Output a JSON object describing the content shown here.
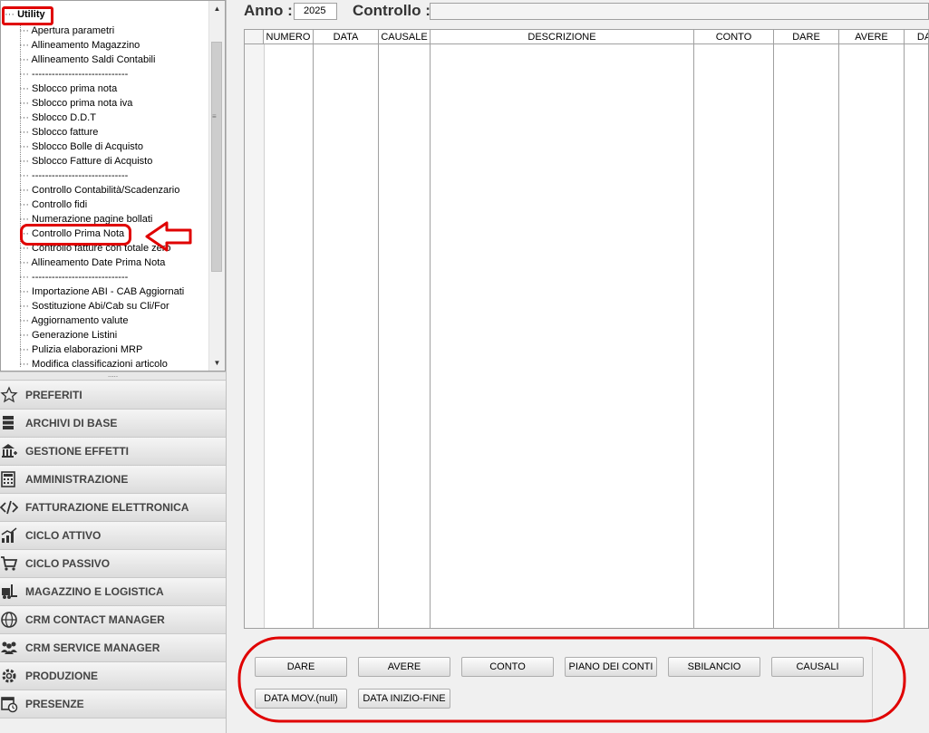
{
  "tree": {
    "root_label": "Utility",
    "items": [
      {
        "label": "Apertura parametri"
      },
      {
        "label": "Allineamento Magazzino"
      },
      {
        "label": "Allineamento Saldi Contabili"
      },
      {
        "label": "-----------------------------"
      },
      {
        "label": "Sblocco prima nota"
      },
      {
        "label": "Sblocco prima nota iva"
      },
      {
        "label": "Sblocco D.D.T"
      },
      {
        "label": "Sblocco fatture"
      },
      {
        "label": "Sblocco Bolle di Acquisto"
      },
      {
        "label": "Sblocco Fatture di Acquisto"
      },
      {
        "label": "-----------------------------"
      },
      {
        "label": "Controllo Contabilità/Scadenzario"
      },
      {
        "label": "Controllo fidi"
      },
      {
        "label": "Numerazione pagine bollati"
      },
      {
        "label": "Controllo Prima Nota"
      },
      {
        "label": "Controllo fatture con totale zero"
      },
      {
        "label": "Allineamento Date Prima Nota"
      },
      {
        "label": "-----------------------------"
      },
      {
        "label": "Importazione ABI - CAB Aggiornati"
      },
      {
        "label": "Sostituzione Abi/Cab su Cli/For"
      },
      {
        "label": "Aggiornamento valute"
      },
      {
        "label": "Generazione Listini"
      },
      {
        "label": "Pulizia elaborazioni MRP"
      },
      {
        "label": "Modifica classificazioni articolo"
      }
    ]
  },
  "nav": [
    {
      "label": "PREFERITI",
      "icon": "star-icon"
    },
    {
      "label": "ARCHIVI DI BASE",
      "icon": "database-icon"
    },
    {
      "label": "GESTIONE EFFETTI",
      "icon": "bank-icon"
    },
    {
      "label": "AMMINISTRAZIONE",
      "icon": "calculator-icon"
    },
    {
      "label": "FATTURAZIONE ELETTRONICA",
      "icon": "code-icon"
    },
    {
      "label": "CICLO ATTIVO",
      "icon": "chart-icon"
    },
    {
      "label": "CICLO PASSIVO",
      "icon": "cart-icon"
    },
    {
      "label": "MAGAZZINO E LOGISTICA",
      "icon": "forklift-icon"
    },
    {
      "label": "CRM CONTACT MANAGER",
      "icon": "globe-icon"
    },
    {
      "label": "CRM SERVICE MANAGER",
      "icon": "people-icon"
    },
    {
      "label": "PRODUZIONE",
      "icon": "gear-icon"
    },
    {
      "label": "PRESENZE",
      "icon": "calendar-clock-icon"
    }
  ],
  "header": {
    "anno_label": "Anno :",
    "anno_value": "2025",
    "controllo_label": "Controllo :",
    "controllo_value": ""
  },
  "grid": {
    "columns": [
      "NUMERO",
      "DATA",
      "CAUSALE",
      "DESCRIZIONE",
      "CONTO",
      "DARE",
      "AVERE",
      "DAR"
    ]
  },
  "buttons": {
    "dare": "DARE",
    "avere": "AVERE",
    "conto": "CONTO",
    "piano": "PIANO DEI CONTI",
    "sbilancio": "SBILANCIO",
    "causali": "CAUSALI",
    "data_mov": "DATA MOV.(null)",
    "data_inizio_fine": "DATA INIZIO-FINE"
  },
  "colors": {
    "annotation_red": "#e00000"
  }
}
